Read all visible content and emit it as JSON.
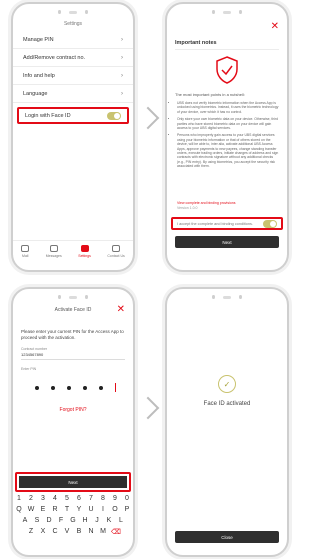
{
  "screen1": {
    "title": "Settings",
    "menu": [
      {
        "label": "Manage PIN"
      },
      {
        "label": "Add/Remove contract no."
      },
      {
        "label": "Info and help"
      },
      {
        "label": "Language"
      }
    ],
    "faceid_label": "Login with Face ID",
    "tabs": [
      {
        "label": "Mail"
      },
      {
        "label": "Messages"
      },
      {
        "label": "Settings"
      },
      {
        "label": "Contact Us"
      }
    ],
    "accent_color": "#e30b17",
    "toggle_color": "#c9c36f"
  },
  "screen2": {
    "heading": "Important notes",
    "subheading": "The most important points in a nutshell:",
    "bullets": [
      "UBS does not verify biometric information when the Access App is unlocked using biometrics. Instead, it uses the biometric technology of your device, over which it has no control.",
      "Only store your own biometric data on your device. Otherwise, third parties who have stored biometric data on your device will gain access to your UBS digital services.",
      "Persons who improperly gain access to your UBS digital services using your biometric information or that of others stored on the device, will be able to, inter alia, activate additional UBS Access Apps, approve payments to new payees, change standing transfer orders, execute trading orders, initiate changes of address and sign contracts with electronic signature without any additional checks (e.g., PIN entry). By using biometrics, you accept the security risk associated with them."
    ],
    "link": "View complete and binding provisions",
    "version": "Version 1.0.0",
    "accept_label": "I accept the complete and binding conditions.",
    "next_label": "Next"
  },
  "screen3": {
    "title": "Activate Face ID",
    "info": "Please enter your current PIN for the Access App to proceed with the activation.",
    "contract_label": "Contract number",
    "contract_value": "1234567890",
    "pin_label": "Enter PIN",
    "forgot": "Forgot PIN?",
    "next_label": "Next",
    "keys_row1": [
      "1",
      "2",
      "3",
      "4",
      "5",
      "6",
      "7",
      "8",
      "9",
      "0"
    ],
    "keys_row2": [
      "Q",
      "W",
      "E",
      "R",
      "T",
      "Y",
      "U",
      "I",
      "O",
      "P"
    ],
    "keys_row3": [
      "A",
      "S",
      "D",
      "F",
      "G",
      "H",
      "J",
      "K",
      "L"
    ],
    "keys_row4": [
      "Z",
      "X",
      "C",
      "V",
      "B",
      "N",
      "M",
      "⌫"
    ]
  },
  "screen4": {
    "message": "Face ID activated",
    "close_label": "Close"
  }
}
